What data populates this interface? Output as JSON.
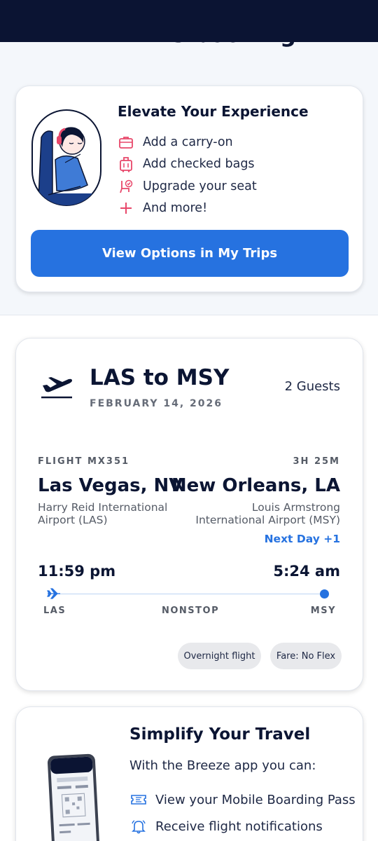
{
  "page": {
    "partial_heading": "with this booking."
  },
  "upsell": {
    "title": "Elevate Your Experience",
    "items": [
      {
        "label": "Add a carry-on",
        "icon": "briefcase-icon"
      },
      {
        "label": "Add checked bags",
        "icon": "luggage-icon"
      },
      {
        "label": "Upgrade your seat",
        "icon": "seat-upgrade-icon"
      },
      {
        "label": "And more!",
        "icon": "plus-icon"
      }
    ],
    "cta_label": "View Options in My Trips",
    "accent_color": "#e8476a",
    "button_color": "#2672e0"
  },
  "trip": {
    "route": "LAS to MSY",
    "date": "FEBRUARY 14, 2026",
    "guests": "2 Guests",
    "flight_number": "FLIGHT MX351",
    "duration": "3H 25M",
    "origin": {
      "city": "Las Vegas, NV",
      "airport": "Harry Reid International Airport (LAS)",
      "time": "11:59 pm",
      "code": "LAS"
    },
    "destination": {
      "city": "New Orleans, LA",
      "airport": "Louis Armstrong International Airport (MSY)",
      "time": "5:24 am",
      "code": "MSY"
    },
    "next_day": "Next Day +1",
    "stops": "NONSTOP",
    "tags": [
      "Overnight flight",
      "Fare: No Flex"
    ]
  },
  "app_promo": {
    "title": "Simplify Your Travel",
    "subtitle": "With the Breeze app you can:",
    "features": [
      {
        "label": "View your Mobile Boarding Pass",
        "icon": "ticket-icon"
      },
      {
        "label": "Receive flight notifications",
        "icon": "bell-icon"
      }
    ]
  },
  "colors": {
    "navy": "#0b1433",
    "link_blue": "#2672e0"
  }
}
